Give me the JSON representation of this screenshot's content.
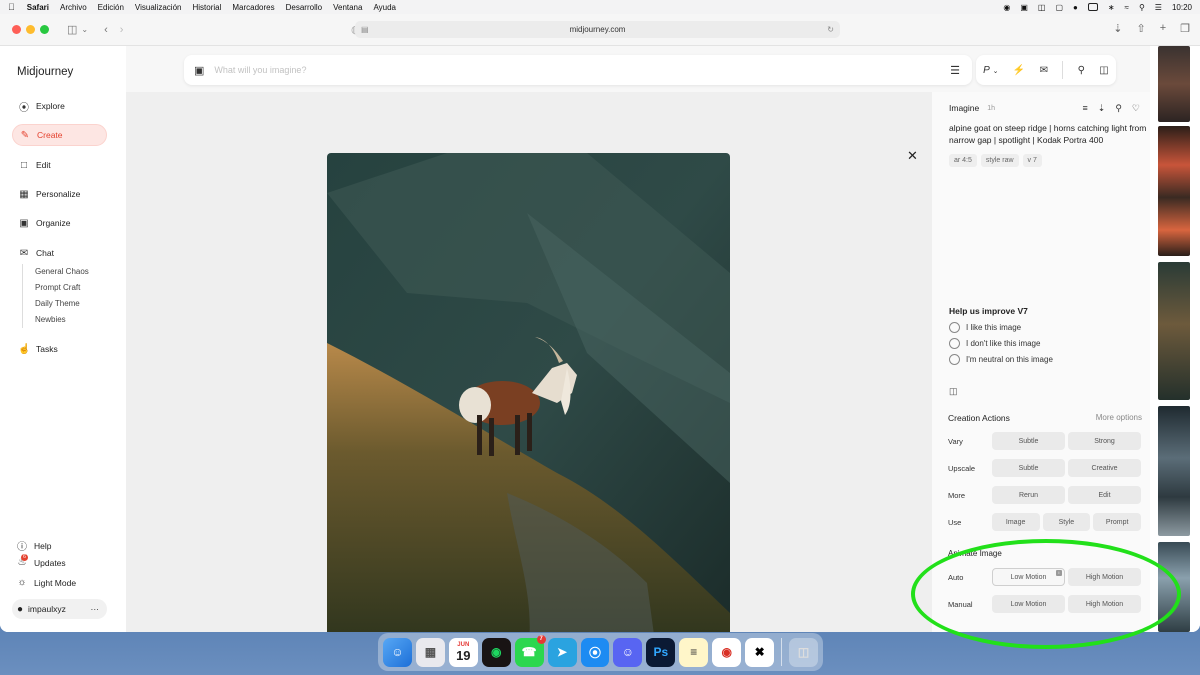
{
  "menubar": {
    "app": "Safari",
    "items": [
      "Archivo",
      "Edición",
      "Visualización",
      "Historial",
      "Marcadores",
      "Desarrollo",
      "Ventana",
      "Ayuda"
    ],
    "clock": "10:20"
  },
  "browser": {
    "url": "midjourney.com"
  },
  "sidebar": {
    "brand": "Midjourney",
    "nav": [
      {
        "label": "Explore",
        "icon": "compass-icon"
      },
      {
        "label": "Create",
        "icon": "brush-icon"
      },
      {
        "label": "Edit",
        "icon": "edit-icon"
      },
      {
        "label": "Personalize",
        "icon": "personalize-icon"
      },
      {
        "label": "Organize",
        "icon": "image-icon"
      },
      {
        "label": "Chat",
        "icon": "chat-icon"
      }
    ],
    "chat_rooms": [
      "General Chaos",
      "Prompt Craft",
      "Daily Theme",
      "Newbies"
    ],
    "tasks": "Tasks",
    "help": "Help",
    "updates": "Updates",
    "updates_count": "6",
    "light_mode": "Light Mode",
    "user": "impaulxyz",
    "user_menu": "···"
  },
  "imagine": {
    "placeholder": "What will you imagine?",
    "param_label": "P"
  },
  "detail": {
    "kind": "Imagine",
    "ago": "1h",
    "prompt": "alpine goat on steep ridge | horns catching light from narrow gap | spotlight | Kodak Portra 400",
    "tags": [
      "ar 4:5",
      "style raw",
      "v 7"
    ],
    "improve_title": "Help us improve V7",
    "feedback": [
      "I like this image",
      "I don't like this image",
      "I'm neutral on this image"
    ],
    "creation_title": "Creation Actions",
    "more_options": "More options",
    "vary": {
      "label": "Vary",
      "a": "Subtle",
      "b": "Strong"
    },
    "upscale": {
      "label": "Upscale",
      "a": "Subtle",
      "b": "Creative"
    },
    "more": {
      "label": "More",
      "a": "Rerun",
      "b": "Edit"
    },
    "use": {
      "label": "Use",
      "a": "Image",
      "b": "Style",
      "c": "Prompt"
    },
    "animate_title": "Animate Image",
    "auto": {
      "label": "Auto",
      "a": "Low Motion",
      "b": "High Motion"
    },
    "manual": {
      "label": "Manual",
      "a": "Low Motion",
      "b": "High Motion"
    }
  },
  "dock": {
    "calendar_month": "JUN",
    "calendar_day": "19",
    "whatsapp_badge": "7",
    "photoshop_label": "Ps"
  },
  "colors": {
    "accent": "#e4412e",
    "annotation": "#22e01a"
  }
}
